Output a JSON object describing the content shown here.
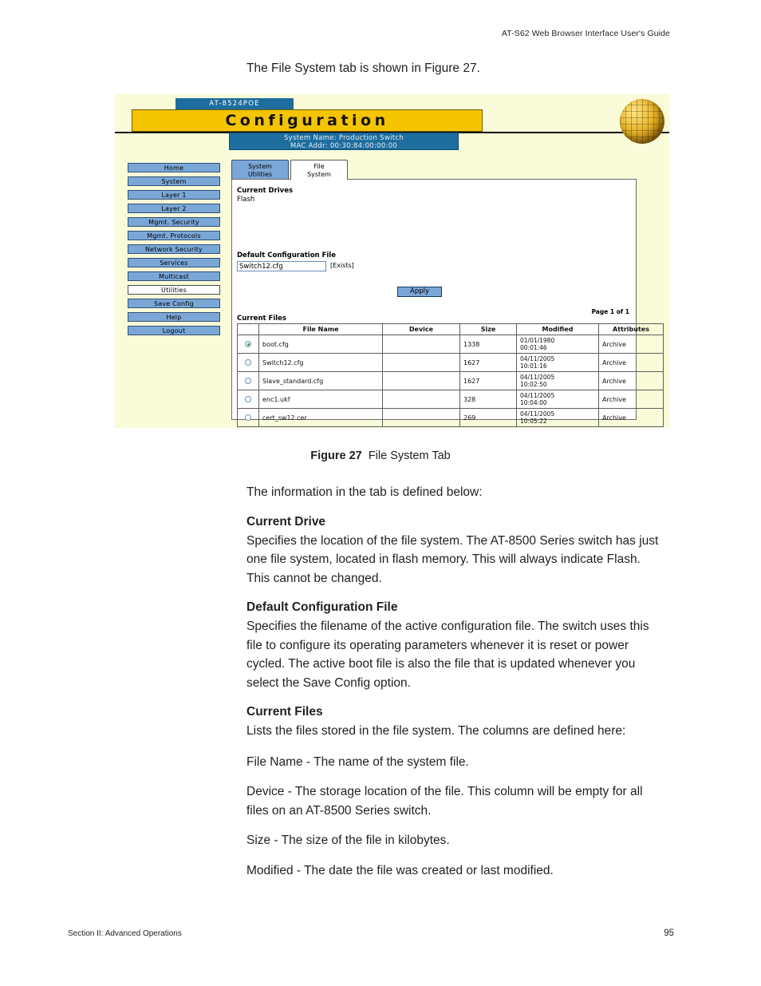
{
  "page": {
    "running_head": "AT-S62 Web Browser Interface User's Guide",
    "intro_line": "The File System tab is shown in Figure 27.",
    "caption_label": "Figure 27",
    "caption_text": "File System Tab",
    "footer_section": "Section II: Advanced Operations",
    "footer_page": "95"
  },
  "figure": {
    "device_tag": "AT-8524POE",
    "banner_title": "Configuration",
    "system_name": "System Name: Production Switch",
    "mac_addr": "MAC Addr: 00:30:84:00:00:00",
    "nav": [
      {
        "label": "Home",
        "active": false
      },
      {
        "label": "System",
        "active": false
      },
      {
        "label": "Layer 1",
        "active": false
      },
      {
        "label": "Layer 2",
        "active": false
      },
      {
        "label": "Mgmt. Security",
        "active": false
      },
      {
        "label": "Mgmt. Protocols",
        "active": false
      },
      {
        "label": "Network Security",
        "active": false
      },
      {
        "label": "Services",
        "active": false
      },
      {
        "label": "Multicast",
        "active": false
      },
      {
        "label": "Utilities",
        "active": true
      },
      {
        "label": "Save Config",
        "active": false
      },
      {
        "label": "Help",
        "active": false
      },
      {
        "label": "Logout",
        "active": false
      }
    ],
    "tabs": {
      "inactive_line1": "System",
      "inactive_line2": "Utilities",
      "active_line1": "File",
      "active_line2": "System"
    },
    "panel": {
      "current_drives_label": "Current Drives",
      "current_drives_value": "Flash",
      "default_config_label": "Default Configuration File",
      "default_config_value": "Switch12.cfg",
      "default_config_status": "[Exists]",
      "apply_label": "Apply",
      "page_of": "Page 1 of 1",
      "current_files_label": "Current Files",
      "columns": [
        "",
        "File Name",
        "Device",
        "Size",
        "Modified",
        "Attributes"
      ],
      "rows": [
        {
          "selected": true,
          "name": "boot.cfg",
          "device": "",
          "size": "1338",
          "mod_date": "01/01/1980",
          "mod_time": "00:01:46",
          "attributes": "Archive"
        },
        {
          "selected": false,
          "name": "Switch12.cfg",
          "device": "",
          "size": "1627",
          "mod_date": "04/11/2005",
          "mod_time": "10:01:16",
          "attributes": "Archive"
        },
        {
          "selected": false,
          "name": "Slave_standard.cfg",
          "device": "",
          "size": "1627",
          "mod_date": "04/11/2005",
          "mod_time": "10:02:50",
          "attributes": "Archive"
        },
        {
          "selected": false,
          "name": "enc1.ukf",
          "device": "",
          "size": "328",
          "mod_date": "04/11/2005",
          "mod_time": "10:04:00",
          "attributes": "Archive"
        },
        {
          "selected": false,
          "name": "cert_sw12.cer",
          "device": "",
          "size": "269",
          "mod_date": "04/11/2005",
          "mod_time": "10:05:22",
          "attributes": "Archive"
        }
      ]
    },
    "colors": {
      "page_bg": "#fafbd8",
      "banner_yellow": "#f5c400",
      "blue_bar": "#1d6d9e",
      "nav_blue": "#7ba7d7"
    }
  },
  "body": {
    "lead": "The information in the tab is defined below:",
    "sections": [
      {
        "heading": "Current Drive",
        "text": "Specifies the location of the file system. The AT-8500 Series switch has just one file system, located in flash memory. This will always indicate Flash. This cannot be changed."
      },
      {
        "heading": "Default Configuration File",
        "text": "Specifies the filename of the active configuration file. The switch uses this file to configure its operating parameters whenever it is reset or power cycled. The active boot file is also the file that is updated whenever you select the Save Config option."
      },
      {
        "heading": "Current Files",
        "text": "Lists the files stored in the file system. The columns are defined here:"
      }
    ],
    "definitions": [
      "File Name - The name of the system file.",
      "Device - The storage location of the file. This column will be empty for all files on an AT-8500 Series switch.",
      "Size - The size of the file in kilobytes.",
      "Modified - The date the file was created or last modified."
    ]
  }
}
